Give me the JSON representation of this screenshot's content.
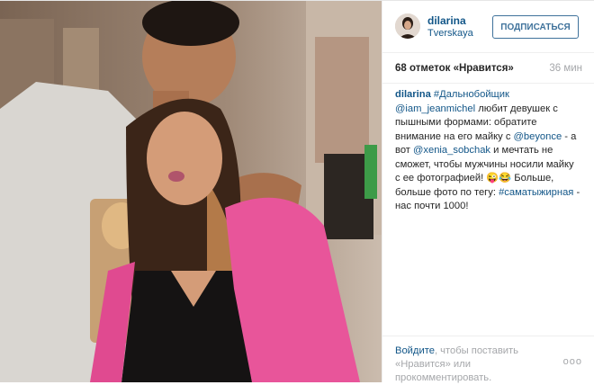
{
  "post": {
    "username": "dilarina",
    "location": "Tverskaya",
    "follow_label": "ПОДПИСАТЬСЯ",
    "likes": "68 отметок «Нравится»",
    "time_ago": "36 мин",
    "caption": {
      "author": "dilarina",
      "hashtag_1": "#Дальнобойщик",
      "mention_1": "@iam_jeanmichel",
      "text_1": "любит девушек с пышными формами: обратите внимание на его майку с",
      "mention_2": "@beyonce",
      "text_2": "- а вот",
      "mention_3": "@xenia_sobchak",
      "text_3": "и мечтать не сможет, чтобы мужчины носили майку с ее фотографией! 😜😂 Больше, больше фото по тегу:",
      "hashtag_2": "#саматыжирная",
      "text_4": "- нас почти 1000!"
    },
    "footer": {
      "login_link": "Войдите",
      "login_text": ", чтобы поставить «Нравится» или прокомментировать."
    },
    "more_icon": "ooo"
  },
  "colors": {
    "link": "#125688",
    "follow_border": "#3f729b",
    "muted": "#a5a7aa",
    "pink_jacket": "#e8559a"
  }
}
